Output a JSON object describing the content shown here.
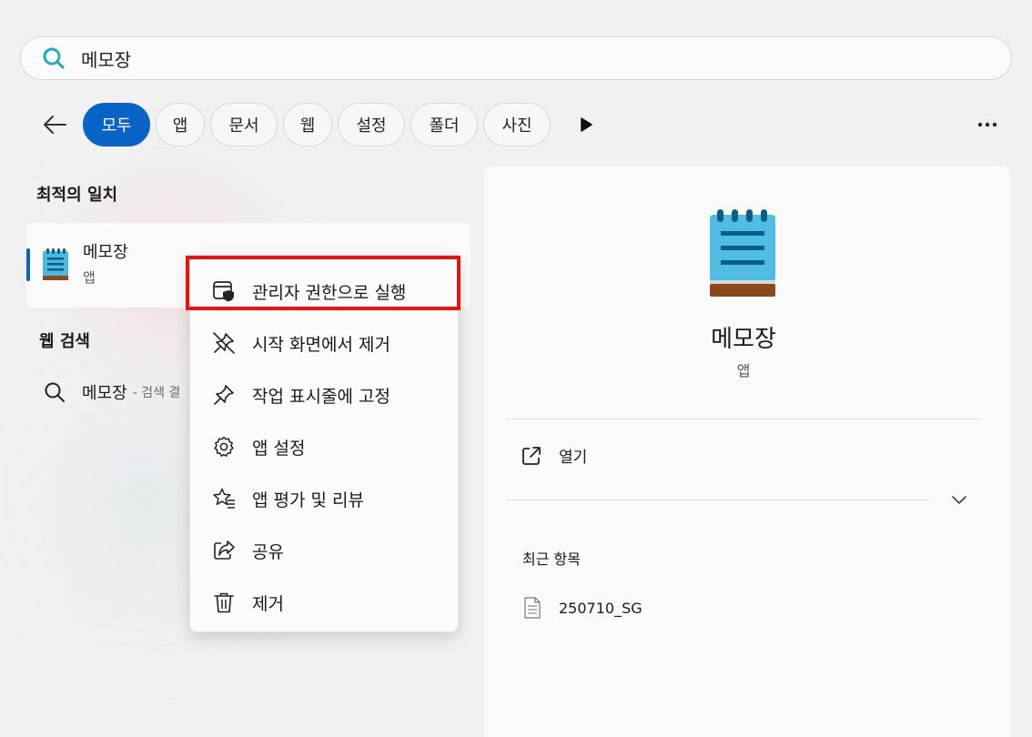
{
  "search": {
    "query": "메모장"
  },
  "filters": {
    "chips": [
      "모두",
      "앱",
      "문서",
      "웹",
      "설정",
      "폴더",
      "사진"
    ],
    "active": "모두"
  },
  "left": {
    "best_match_title": "최적의 일치",
    "best_match": {
      "name": "메모장",
      "type": "앱"
    },
    "web_search_title": "웹 검색",
    "web_search": {
      "query": "메모장",
      "suffix": "- 검색 결"
    }
  },
  "context_menu": {
    "items": [
      {
        "label": "관리자 권한으로 실행",
        "icon": "shield-window-icon"
      },
      {
        "label": "시작 화면에서 제거",
        "icon": "unpin-icon"
      },
      {
        "label": "작업 표시줄에 고정",
        "icon": "pin-icon"
      },
      {
        "label": "앱 설정",
        "icon": "gear-icon"
      },
      {
        "label": "앱 평가 및 리뷰",
        "icon": "star-review-icon"
      },
      {
        "label": "공유",
        "icon": "share-icon"
      },
      {
        "label": "제거",
        "icon": "trash-icon"
      }
    ],
    "highlight_color": "#e8130c"
  },
  "panel": {
    "app_name": "메모장",
    "app_type": "앱",
    "open_label": "열기",
    "recent_title": "최근 항목",
    "recent_items": [
      "250710_SG"
    ]
  },
  "colors": {
    "accent": "#0a63c6",
    "highlight": "#e8130c"
  }
}
